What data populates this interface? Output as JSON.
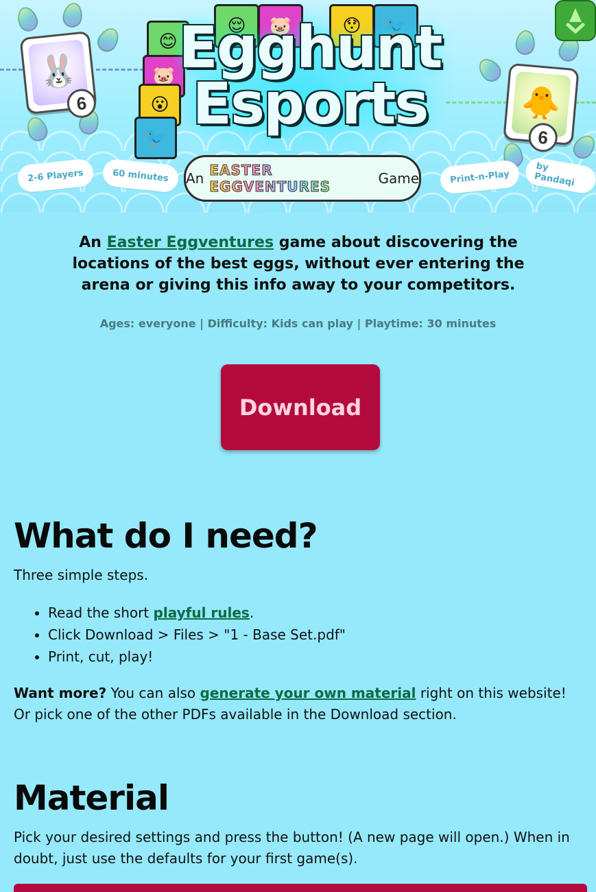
{
  "header": {
    "title_line1": "Egghunt",
    "title_line2": "Esports",
    "subtitle_prefix": "An",
    "subtitle_brand": "EASTER EGGVENTURES",
    "subtitle_suffix": "Game",
    "card_left_number": "6",
    "card_right_number": "6",
    "badges": [
      "2-6 Players",
      "60 minutes",
      "Print-n-Play",
      "by Pandaqi"
    ]
  },
  "intro": {
    "prefix": "An",
    "link": "Easter Eggventures",
    "rest": "game about discovering the locations of the best eggs, without ever entering the arena or giving this info away to your competitors."
  },
  "meta": "Ages: everyone | Difficulty: Kids can play | Playtime: 30 minutes",
  "download_button": "Download",
  "need": {
    "heading": "What do I need?",
    "lead": "Three simple steps.",
    "step1_prefix": "Read the short",
    "step1_link": "playful rules",
    "step1_suffix": ".",
    "step2": "Click Download > Files > \"1 - Base Set.pdf\"",
    "step3": "Print, cut, play!",
    "more_bold": "Want more?",
    "more_prefix": "You can also",
    "more_link": "generate your own material",
    "more_rest": "right on this website! Or pick one of the other PDFs available in the Download section."
  },
  "material": {
    "heading": "Material",
    "text": "Pick your desired settings and press the button! (A new page will open.) When in doubt, just use the defaults for your first game(s)."
  },
  "colors": {
    "background": "#95e9fb",
    "accent": "#b30a3e",
    "link": "#0e6a44"
  }
}
